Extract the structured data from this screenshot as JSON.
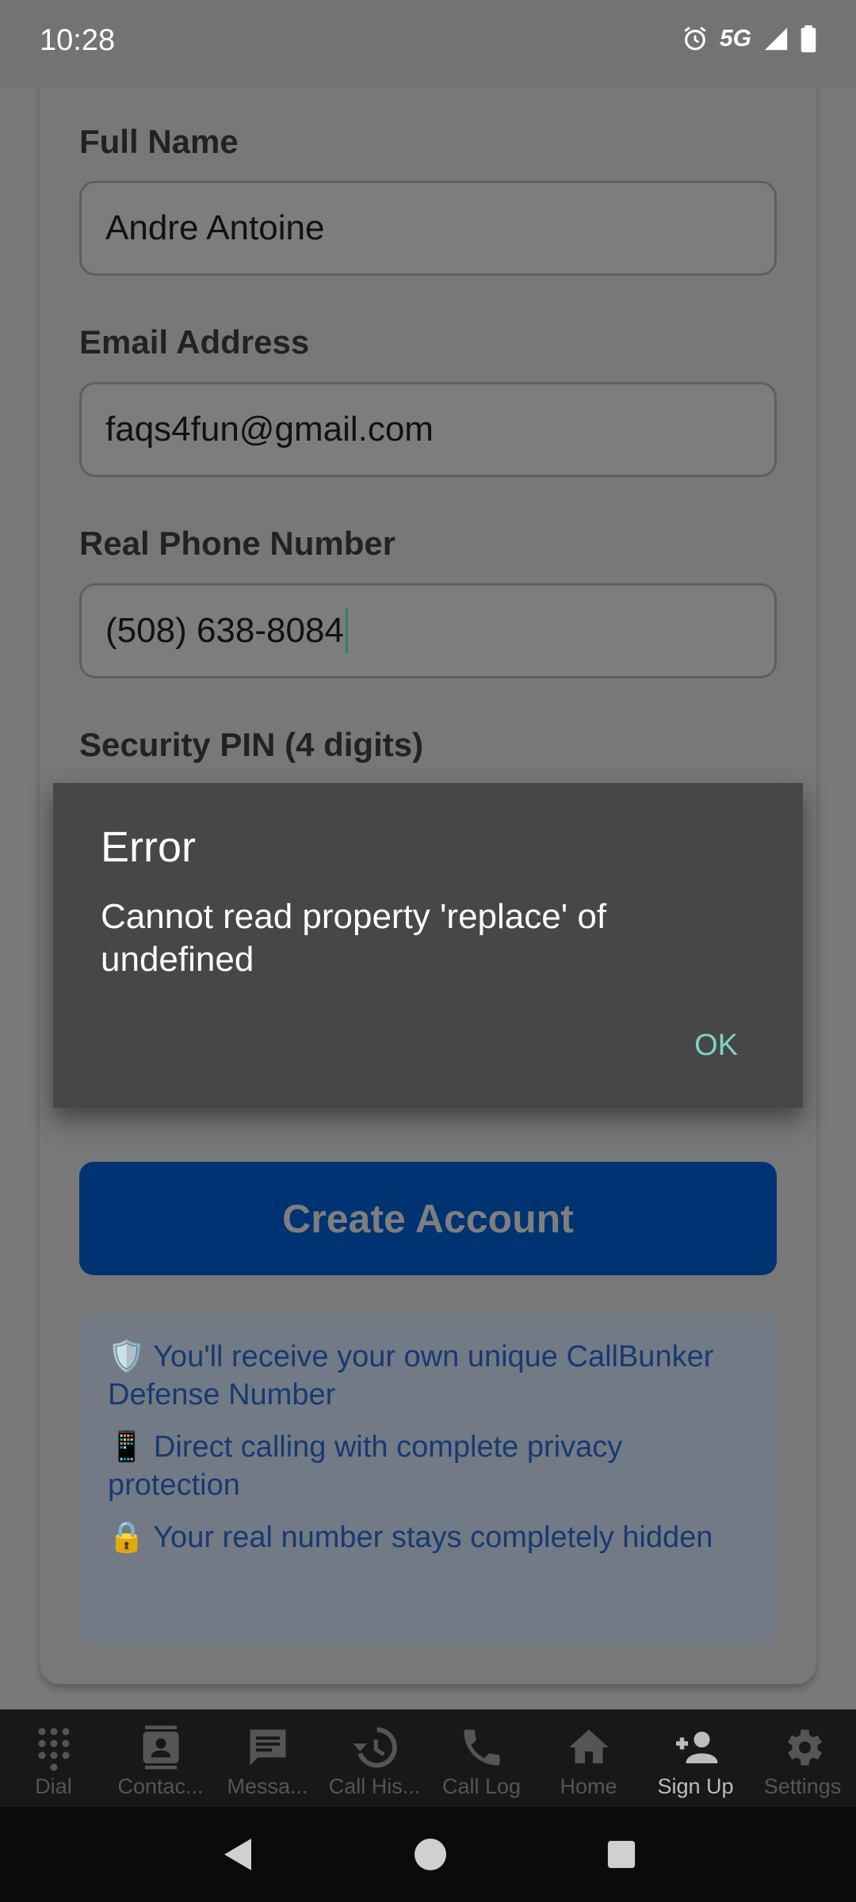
{
  "status_bar": {
    "time": "10:28",
    "network": "5G"
  },
  "form": {
    "full_name_label": "Full Name",
    "full_name_value": "Andre Antoine",
    "email_label": "Email Address",
    "email_value": "faqs4fun@gmail.com",
    "phone_label": "Real Phone Number",
    "phone_value": "(508) 638-8084",
    "pin_label": "Security PIN (4 digits)",
    "create_button": "Create Account",
    "info": [
      {
        "icon": "🛡️",
        "text": "You'll receive your own unique CallBunker Defense Number"
      },
      {
        "icon": "📱",
        "text": "Direct calling with complete privacy protection"
      },
      {
        "icon": "🔒",
        "text": "Your real number stays completely hidden"
      }
    ]
  },
  "dialog": {
    "title": "Error",
    "message": "Cannot read property 'replace' of undefined",
    "ok_label": "OK"
  },
  "bottom_nav": {
    "items": [
      {
        "label": "Dial",
        "icon": "dialpad-icon"
      },
      {
        "label": "Contac...",
        "icon": "contacts-icon"
      },
      {
        "label": "Messa...",
        "icon": "message-icon"
      },
      {
        "label": "Call His...",
        "icon": "history-icon"
      },
      {
        "label": "Call Log",
        "icon": "phone-icon"
      },
      {
        "label": "Home",
        "icon": "home-icon"
      },
      {
        "label": "Sign Up",
        "icon": "add-person-icon",
        "active": true
      },
      {
        "label": "Settings",
        "icon": "gear-icon"
      }
    ]
  },
  "colors": {
    "primary": "#0053b8",
    "dialog_background": "#474747",
    "ok_accent": "#7fd1c3"
  }
}
